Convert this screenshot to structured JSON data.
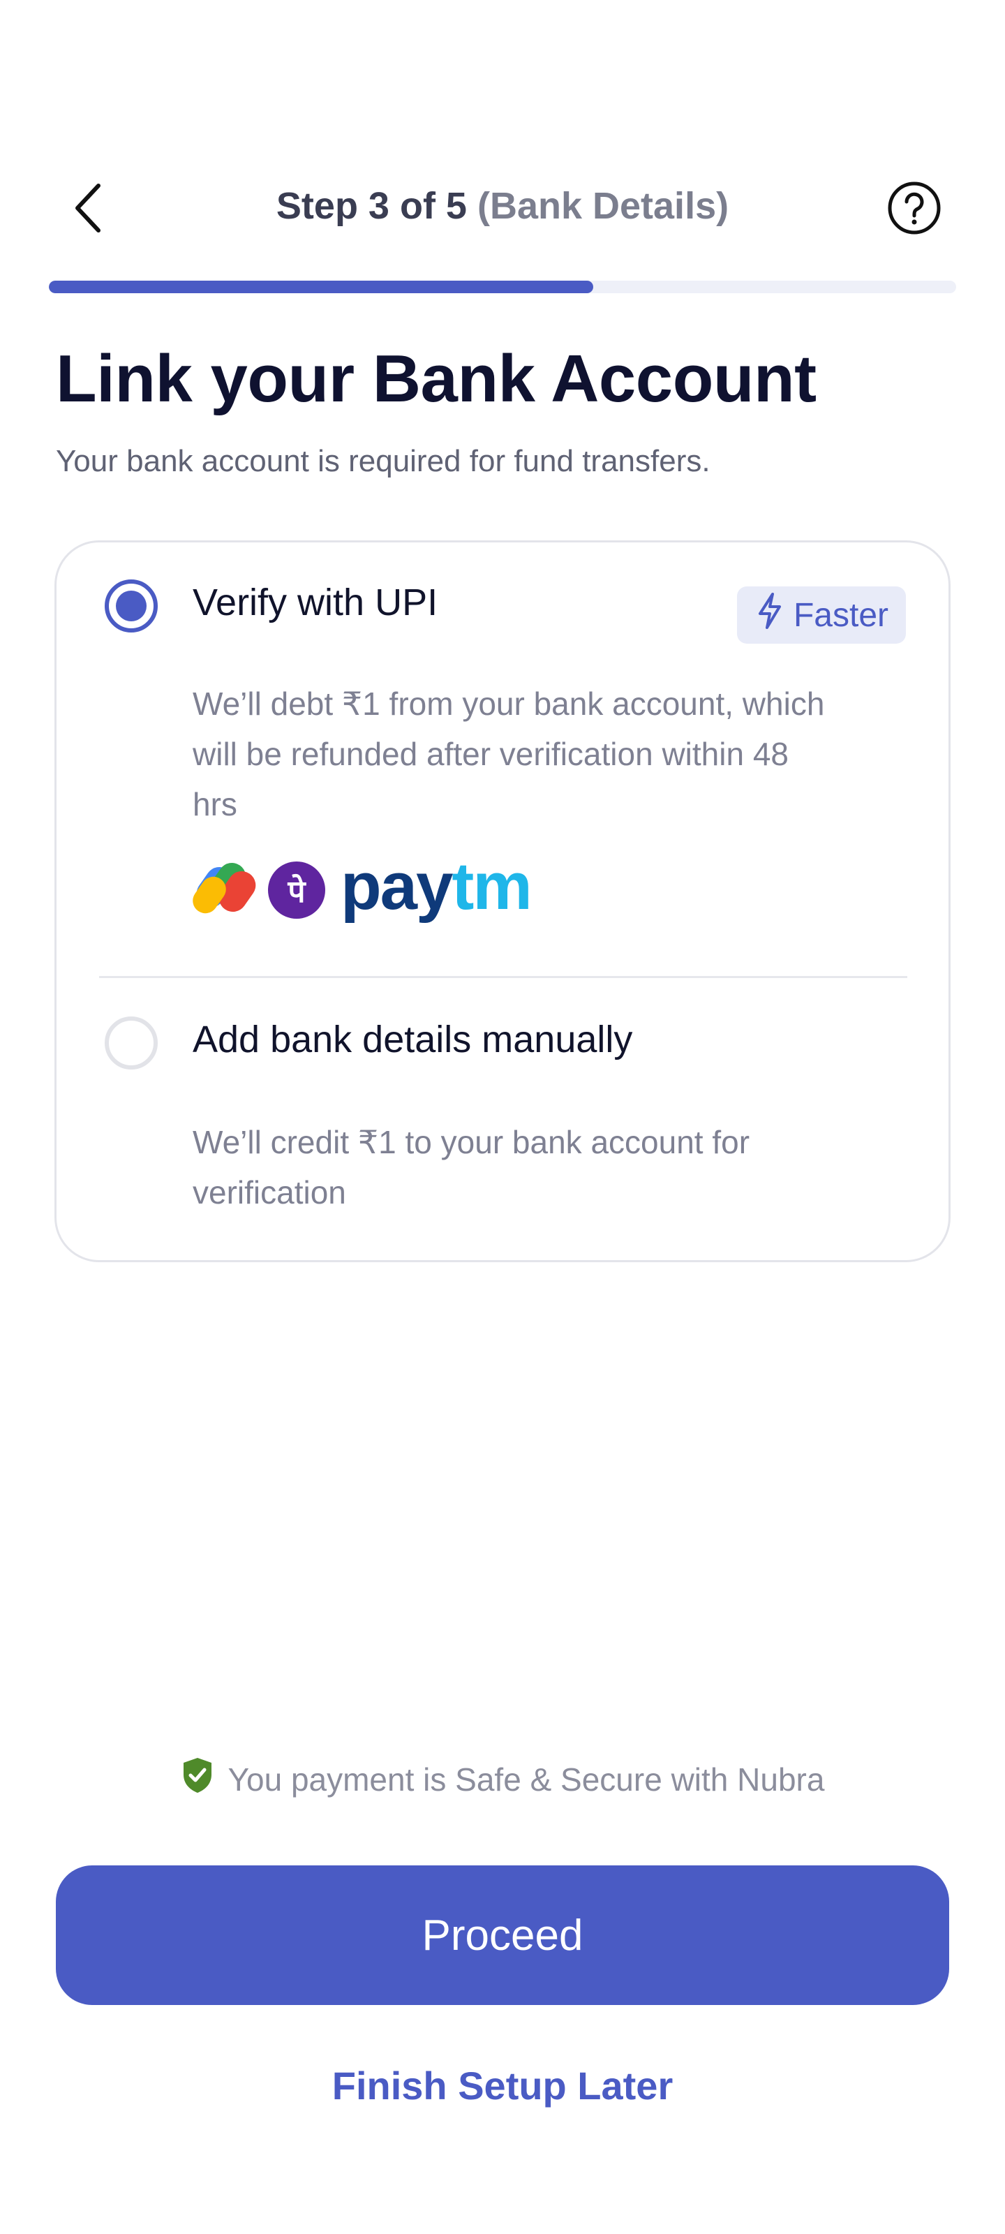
{
  "header": {
    "step": "Step 3 of 5",
    "step_sub": "(Bank Details)",
    "back_icon": "chevron-left-icon",
    "help_icon": "question-circle-icon",
    "progress_fraction": 0.6
  },
  "page": {
    "title": "Link your Bank Account",
    "subtitle": "Your bank account is required for fund transfers."
  },
  "options": [
    {
      "title": "Verify with UPI",
      "selected": true,
      "badge": "Faster",
      "badge_icon": "lightning-icon",
      "desc_lines": [
        "We’ll debt ₹1 from your bank account, which",
        "will be refunded after verification within 48",
        "hrs"
      ],
      "apps": {
        "logos": [
          "google-pay-logo",
          "phonepe-logo"
        ],
        "phonepe_glyph": "पे",
        "paytm_pay": "pay",
        "paytm_tm": "tm"
      }
    },
    {
      "title": "Add bank details manually",
      "selected": false,
      "desc_lines": [
        "We’ll credit ₹1 to your bank account for",
        "verification"
      ]
    }
  ],
  "footer": {
    "secure_text": "You payment is Safe & Secure with Nubra",
    "secure_icon": "shield-check-icon",
    "proceed_label": "Proceed",
    "later_label": "Finish Setup Later"
  },
  "colors": {
    "accent": "#4a5bc4",
    "shield": "#4f8a2a"
  }
}
